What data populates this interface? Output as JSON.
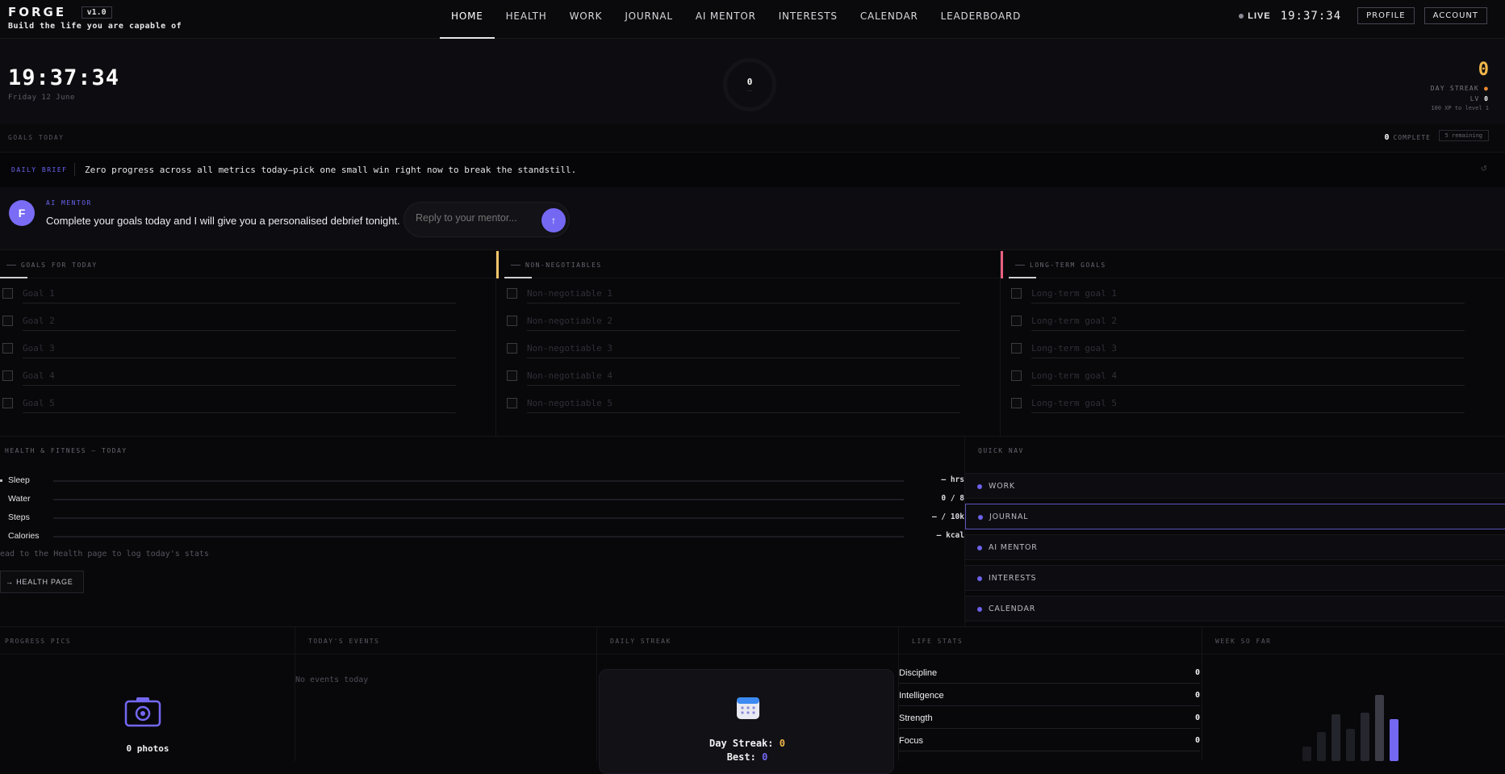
{
  "brand": {
    "name": "FORGE",
    "version": "v1.0",
    "tagline": "Build the life you are capable of"
  },
  "nav": [
    {
      "label": "HOME",
      "active": true
    },
    {
      "label": "HEALTH"
    },
    {
      "label": "WORK"
    },
    {
      "label": "JOURNAL"
    },
    {
      "label": "AI MENTOR"
    },
    {
      "label": "INTERESTS"
    },
    {
      "label": "CALENDAR"
    },
    {
      "label": "LEADERBOARD"
    }
  ],
  "header": {
    "live_label": "LIVE",
    "clock": "19:37:34",
    "profile_label": "PROFILE",
    "account_label": "ACCOUNT"
  },
  "hero": {
    "clock": "19:37:34",
    "date": "Friday 12 June",
    "ring_value": "0",
    "streak_value": "0",
    "streak_label": "DAY STREAK",
    "level_label": "LV",
    "level_value": "0",
    "xp_text": "100 XP to level 1"
  },
  "goals_strip": {
    "title": "GOALS TODAY",
    "complete_count": "0",
    "complete_label": "COMPLETE",
    "remaining": "5 remaining"
  },
  "brief": {
    "label": "DAILY BRIEF",
    "text": "Zero progress across all metrics today—pick one small win right now to break the standstill."
  },
  "mentor": {
    "avatar_letter": "F",
    "label": "AI MENTOR",
    "message": "Complete your goals today and I will give you a personalised debrief tonight.",
    "reply_placeholder": "Reply to your mentor...",
    "send_icon": "↑"
  },
  "columns": [
    {
      "title": "GOALS FOR TODAY",
      "accent": "",
      "items": [
        "Goal 1",
        "Goal 2",
        "Goal 3",
        "Goal 4",
        "Goal 5"
      ]
    },
    {
      "title": "NON-NEGOTIABLES",
      "accent": "#f2c46a",
      "items": [
        "Non-negotiable 1",
        "Non-negotiable 2",
        "Non-negotiable 3",
        "Non-negotiable 4",
        "Non-negotiable 5"
      ]
    },
    {
      "title": "LONG-TERM GOALS",
      "accent": "#e8607e",
      "items": [
        "Long-term goal 1",
        "Long-term goal 2",
        "Long-term goal 3",
        "Long-term goal 4",
        "Long-term goal 5"
      ]
    }
  ],
  "health": {
    "title": "HEALTH & FITNESS — TODAY",
    "rows": [
      {
        "label": "Sleep",
        "value": "— hrs"
      },
      {
        "label": "Water",
        "value": "0 / 8"
      },
      {
        "label": "Steps",
        "value": "— / 10k"
      },
      {
        "label": "Calories",
        "value": "— kcal"
      }
    ],
    "note": "ead to the Health page to log today's stats",
    "button": "→ HEALTH PAGE"
  },
  "quick_nav": {
    "title": "QUICK NAV",
    "items": [
      "WORK",
      "JOURNAL",
      "AI MENTOR",
      "INTERESTS",
      "CALENDAR"
    ],
    "selected": "JOURNAL"
  },
  "bottom": {
    "progress_title": "PROGRESS PICS",
    "photos": "0 photos",
    "events_title": "TODAY'S EVENTS",
    "events_empty": "No events today",
    "streak_title": "DAILY STREAK",
    "streak_label": "Day Streak:",
    "streak_value": "0",
    "best_label": "Best:",
    "best_value": "0",
    "stats_title": "LIFE STATS",
    "stats": [
      {
        "name": "Discipline",
        "value": "0"
      },
      {
        "name": "Intelligence",
        "value": "0"
      },
      {
        "name": "Strength",
        "value": "0"
      },
      {
        "name": "Focus",
        "value": "0"
      }
    ],
    "week_title": "WEEK SO FAR"
  },
  "colors": {
    "accent": "#7468f3",
    "streak": "#f2b64a"
  }
}
